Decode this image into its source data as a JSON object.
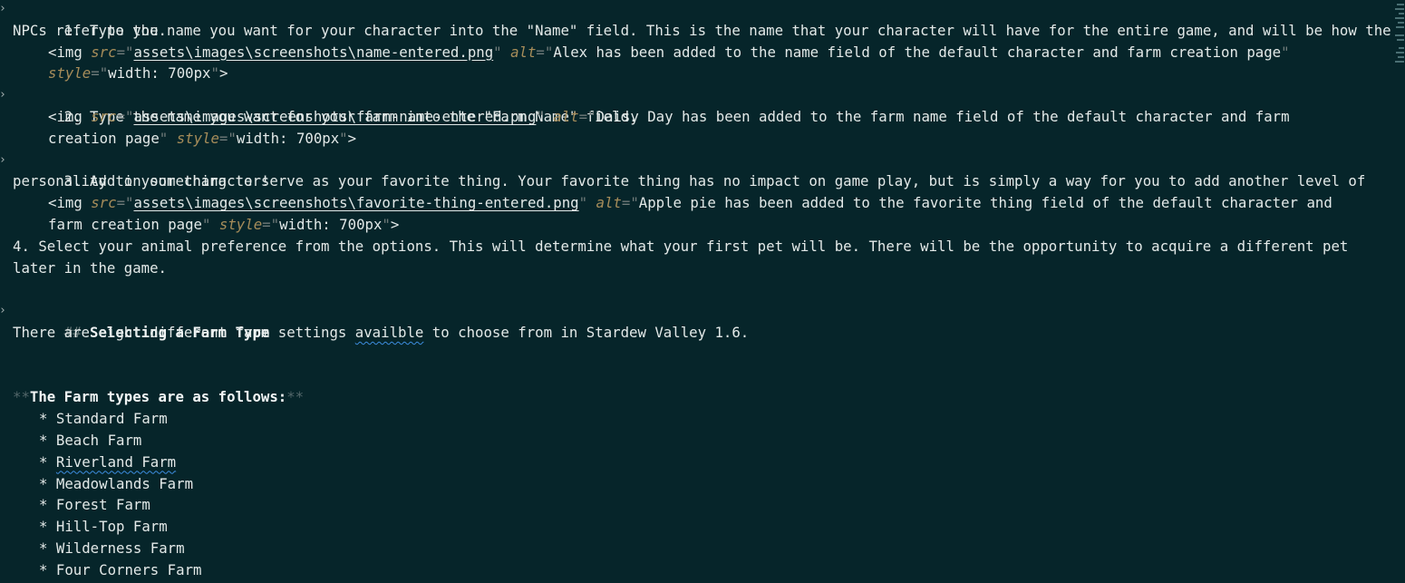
{
  "editor": {
    "fold_icon": "chevron-down-icon",
    "colors": {
      "background": "#06252a",
      "text": "#e3e9e8",
      "attribute": "#a78d5a",
      "punctuation": "#707b7a",
      "spelling_underline": "#3c8de0"
    },
    "list_items": [
      {
        "line1": "1. Type the name you want for your character into the \"Name\" field. This is the name that your character will have for the entire game, and will be how the",
        "line2": "NPCs refer to you.",
        "img": {
          "tag": "<img",
          "src_attr": "src",
          "eq": "=",
          "q": "\"",
          "src": "assets\\images\\screenshots\\name-entered.png",
          "alt_attr": "alt",
          "alt_line1": "Alex has been added to the name field of the default character and farm creation page",
          "alt_line2": "",
          "style_attr": "style",
          "style_value": "width: 700px",
          "close": ">"
        }
      },
      {
        "line1": "2. Type the name you want for your farm into the \"Farm Name\" field.",
        "img": {
          "tag": "<img",
          "src_attr": "src",
          "eq": "=",
          "q": "\"",
          "src": "assets\\images\\screenshots\\farm-name-entered.png",
          "alt_attr": "alt",
          "alt_line1": "Daisy Day has been added to the farm name field of the default character and farm",
          "alt_line2": "creation page",
          "style_attr": "style",
          "style_value": "width: 700px",
          "close": ">"
        }
      },
      {
        "line1": "3. Add in something to serve as your favorite thing. Your favorite thing has no impact on game play, but is simply a way for you to add another level of",
        "line2": "personality to your character!",
        "img": {
          "tag": "<img",
          "src_attr": "src",
          "eq": "=",
          "q": "\"",
          "src": "assets\\images\\screenshots\\favorite-thing-entered.png",
          "alt_attr": "alt",
          "alt_line1": "Apple pie has been added to the favorite thing field of the default character and",
          "alt_line2": "farm creation page",
          "style_attr": "style",
          "style_value": "width: 700px",
          "close": ">"
        }
      },
      {
        "line1": "4. Select your animal preference from the options. This will determine what your first pet will be. There will be the opportunity to acquire a different pet",
        "line2": "later in the game."
      }
    ],
    "section": {
      "marker": "##",
      "title": "Selecting a Farm Type",
      "intro_before": "There are eight different farm settings ",
      "intro_misspelled": "availble",
      "intro_after": " to choose from in Stardew Valley 1.6."
    },
    "farm_types": {
      "bold_marker": "**",
      "heading": "The Farm types are as follows:",
      "bullet": "*",
      "items": [
        "Standard Farm",
        "Beach Farm",
        "Riverland Farm",
        "Meadowlands Farm",
        "Forest Farm",
        "Hill-Top Farm",
        "Wilderness Farm",
        "Four Corners Farm"
      ]
    }
  }
}
